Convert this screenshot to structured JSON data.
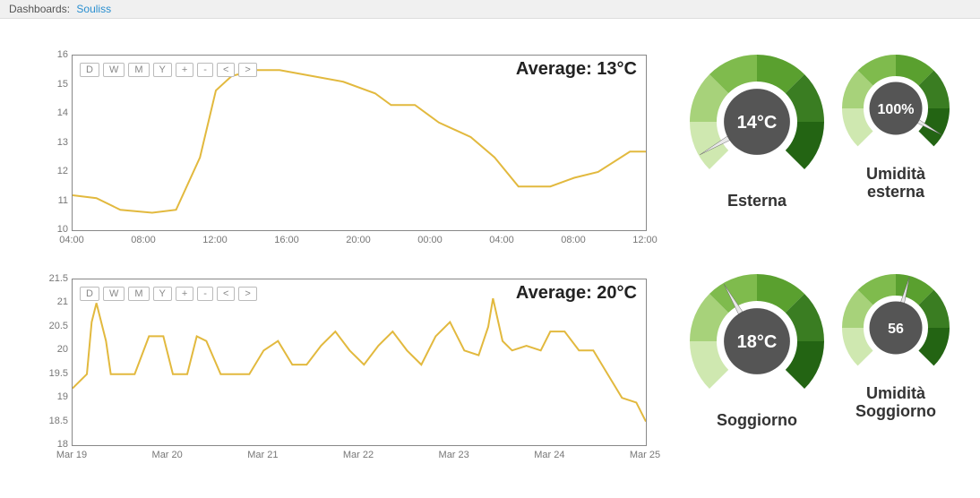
{
  "topbar": {
    "label": "Dashboards:",
    "link": "Souliss"
  },
  "chart_data": [
    {
      "type": "line",
      "title": "Average: 13°C",
      "ylim": [
        10,
        16
      ],
      "yticks": [
        10,
        11,
        12,
        13,
        14,
        15,
        16
      ],
      "xticks": [
        "04:00",
        "08:00",
        "12:00",
        "16:00",
        "20:00",
        "00:00",
        "04:00",
        "08:00",
        "12:00"
      ],
      "buttons": [
        "D",
        "W",
        "M",
        "Y",
        "+",
        "-",
        "<",
        ">"
      ],
      "series": [
        {
          "name": "Esterna",
          "x_index": [
            0,
            0.3,
            0.6,
            1.0,
            1.3,
            1.6,
            1.8,
            2.0,
            2.3,
            2.6,
            3.0,
            3.4,
            3.8,
            4.0,
            4.3,
            4.6,
            5.0,
            5.3,
            5.6,
            5.8,
            6.0,
            6.3,
            6.6,
            7.0,
            7.2
          ],
          "values": [
            11.2,
            11.1,
            10.7,
            10.6,
            10.7,
            12.5,
            14.8,
            15.3,
            15.5,
            15.5,
            15.3,
            15.1,
            14.7,
            14.3,
            14.3,
            13.7,
            13.2,
            12.5,
            11.5,
            11.5,
            11.5,
            11.8,
            12.0,
            12.7,
            12.7
          ]
        }
      ]
    },
    {
      "type": "line",
      "title": "Average: 20°C",
      "ylim": [
        18,
        21.5
      ],
      "yticks": [
        18,
        18.5,
        19,
        19.5,
        20,
        20.5,
        21,
        21.5
      ],
      "xticks": [
        "Mar 19",
        "Mar 20",
        "Mar 21",
        "Mar 22",
        "Mar 23",
        "Mar 24",
        "Mar 25"
      ],
      "buttons": [
        "D",
        "W",
        "M",
        "Y",
        "+",
        "-",
        "<",
        ">"
      ],
      "series": [
        {
          "name": "Soggiorno",
          "x_index": [
            0,
            0.15,
            0.2,
            0.25,
            0.35,
            0.4,
            0.55,
            0.65,
            0.8,
            0.95,
            1.05,
            1.2,
            1.3,
            1.4,
            1.55,
            1.7,
            1.85,
            2.0,
            2.15,
            2.3,
            2.45,
            2.6,
            2.75,
            2.9,
            3.05,
            3.2,
            3.35,
            3.5,
            3.65,
            3.8,
            3.95,
            4.1,
            4.25,
            4.35,
            4.4,
            4.5,
            4.6,
            4.75,
            4.9,
            5.0,
            5.15,
            5.3,
            5.45,
            5.6,
            5.75,
            5.9,
            6.0
          ],
          "values": [
            19.2,
            19.5,
            20.6,
            21.0,
            20.2,
            19.5,
            19.5,
            19.5,
            20.3,
            20.3,
            19.5,
            19.5,
            20.3,
            20.2,
            19.5,
            19.5,
            19.5,
            20.0,
            20.2,
            19.7,
            19.7,
            20.1,
            20.4,
            20.0,
            19.7,
            20.1,
            20.4,
            20.0,
            19.7,
            20.3,
            20.6,
            20.0,
            19.9,
            20.5,
            21.1,
            20.2,
            20.0,
            20.1,
            20.0,
            20.4,
            20.4,
            20.0,
            20.0,
            19.5,
            19.0,
            18.9,
            18.5
          ]
        }
      ]
    }
  ],
  "gauges": [
    {
      "value": "14°C",
      "label": "Esterna",
      "angle": -120,
      "size": "large"
    },
    {
      "value": "100%",
      "label": "Umidità esterna",
      "angle": 120,
      "size": "small"
    },
    {
      "value": "18°C",
      "label": "Soggiorno",
      "angle": -30,
      "size": "large"
    },
    {
      "value": "56",
      "label": "Umidità Soggiorno",
      "angle": 15,
      "size": "small"
    }
  ]
}
